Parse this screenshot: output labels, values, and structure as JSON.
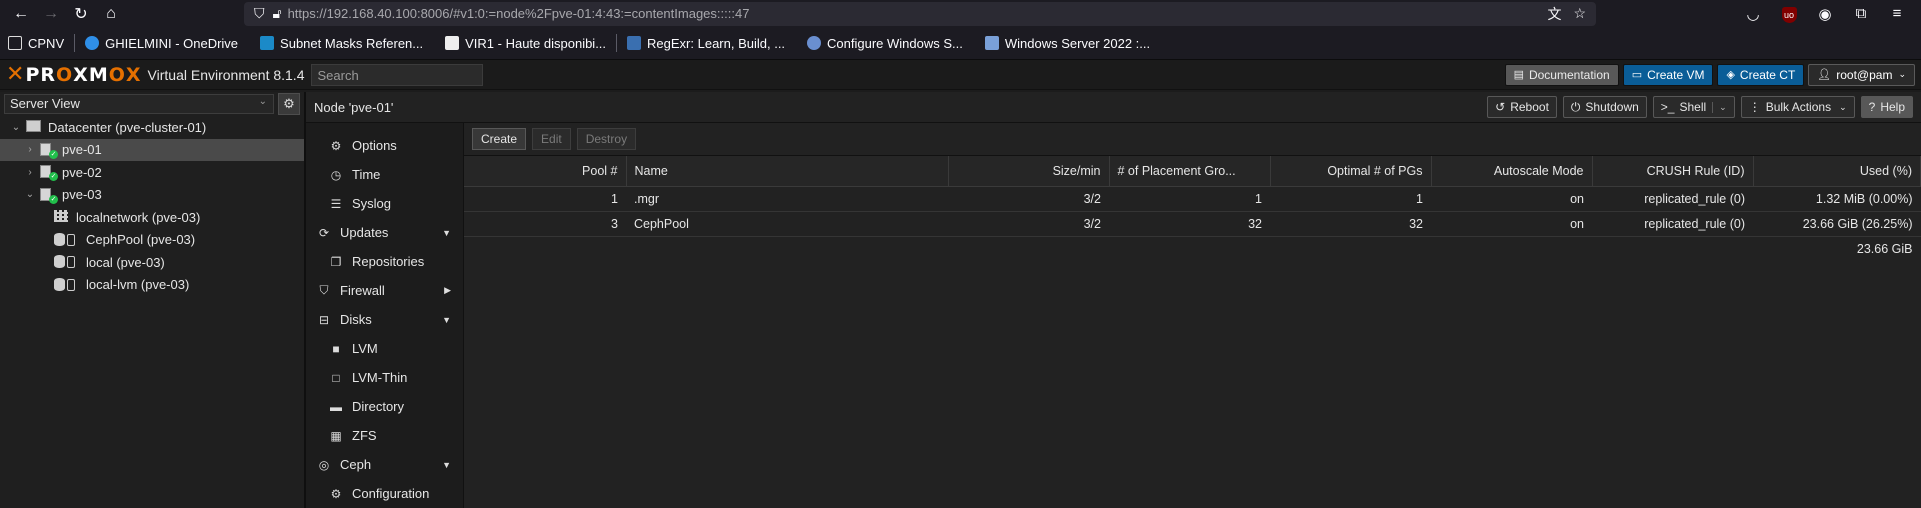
{
  "browser": {
    "url_host": "https://192.168.40.100",
    "url_rest": ":8006/#v1:0:=node%2Fpve-01:4:43:=contentImages:::::47",
    "bookmarks": [
      "CPNV",
      "GHIELMINI - OneDrive",
      "Subnet Masks Referen...",
      "VIR1 - Haute disponibi...",
      "RegExr: Learn, Build, ...",
      "Configure Windows S...",
      "Windows Server 2022 :..."
    ]
  },
  "header": {
    "logo": "PROXMOX",
    "version": "Virtual Environment 8.1.4",
    "search_placeholder": "Search",
    "documentation": "Documentation",
    "create_vm": "Create VM",
    "create_ct": "Create CT",
    "user": "root@pam"
  },
  "tree": {
    "view": "Server View",
    "datacenter": "Datacenter (pve-cluster-01)",
    "nodes": [
      "pve-01",
      "pve-02",
      "pve-03"
    ],
    "storage": [
      "localnetwork (pve-03)",
      "CephPool (pve-03)",
      "local (pve-03)",
      "local-lvm (pve-03)"
    ]
  },
  "nodebar": {
    "title": "Node 'pve-01'",
    "reboot": "Reboot",
    "shutdown": "Shutdown",
    "shell": "Shell",
    "bulk": "Bulk Actions",
    "help": "Help"
  },
  "menu": [
    "Options",
    "Time",
    "Syslog",
    "Updates",
    "Repositories",
    "Firewall",
    "Disks",
    "LVM",
    "LVM-Thin",
    "Directory",
    "ZFS",
    "Ceph",
    "Configuration"
  ],
  "toolbar": {
    "create": "Create",
    "edit": "Edit",
    "destroy": "Destroy"
  },
  "table": {
    "columns": [
      "Pool #",
      "Name",
      "Size/min",
      "# of Placement Gro...",
      "Optimal # of PGs",
      "Autoscale Mode",
      "CRUSH Rule (ID)",
      "Used (%)"
    ],
    "rows": [
      [
        "1",
        ".mgr",
        "3/2",
        "1",
        "1",
        "on",
        "replicated_rule (0)",
        "1.32 MiB (0.00%)"
      ],
      [
        "3",
        "CephPool",
        "3/2",
        "32",
        "32",
        "on",
        "replicated_rule (0)",
        "23.66 GiB (26.25%)"
      ]
    ],
    "total": "23.66 GiB"
  }
}
